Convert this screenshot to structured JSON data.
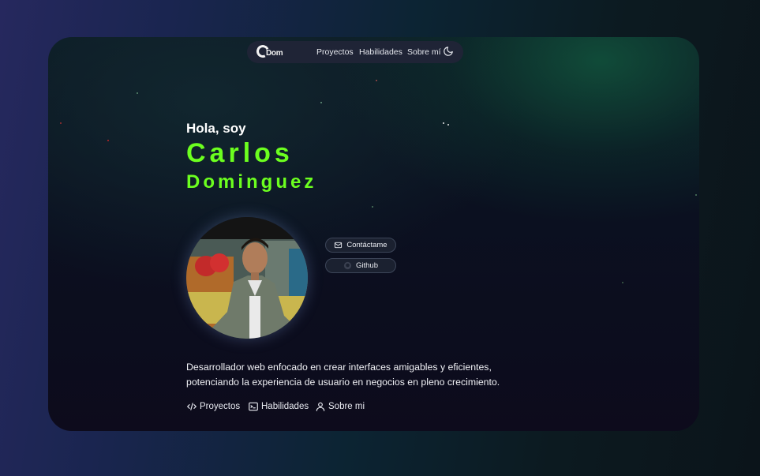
{
  "nav": {
    "logo_text": "Dom",
    "links": [
      "Proyectos",
      "Habilidades",
      "Sobre mí"
    ],
    "theme_icon": "moon-icon"
  },
  "hero": {
    "greeting": "Hola, soy",
    "first_name": "Carlos",
    "last_name": "Dominguez"
  },
  "buttons": {
    "contact": {
      "label": "Contáctame",
      "icon": "mail-icon"
    },
    "github": {
      "label": "Github",
      "icon": "github-icon"
    }
  },
  "description": "Desarrollador web enfocado en crear interfaces amigables y eficientes, potenciando la experiencia de usuario en negocios en pleno crecimiento.",
  "bottom_links": [
    {
      "label": "Proyectos",
      "icon": "code-icon"
    },
    {
      "label": "Habilidades",
      "icon": "terminal-icon"
    },
    {
      "label": "Sobre mi",
      "icon": "user-icon"
    }
  ],
  "colors": {
    "accent": "#6cff1f",
    "card_bg": "#0d0b1c",
    "nav_bg": "#1f2436"
  }
}
